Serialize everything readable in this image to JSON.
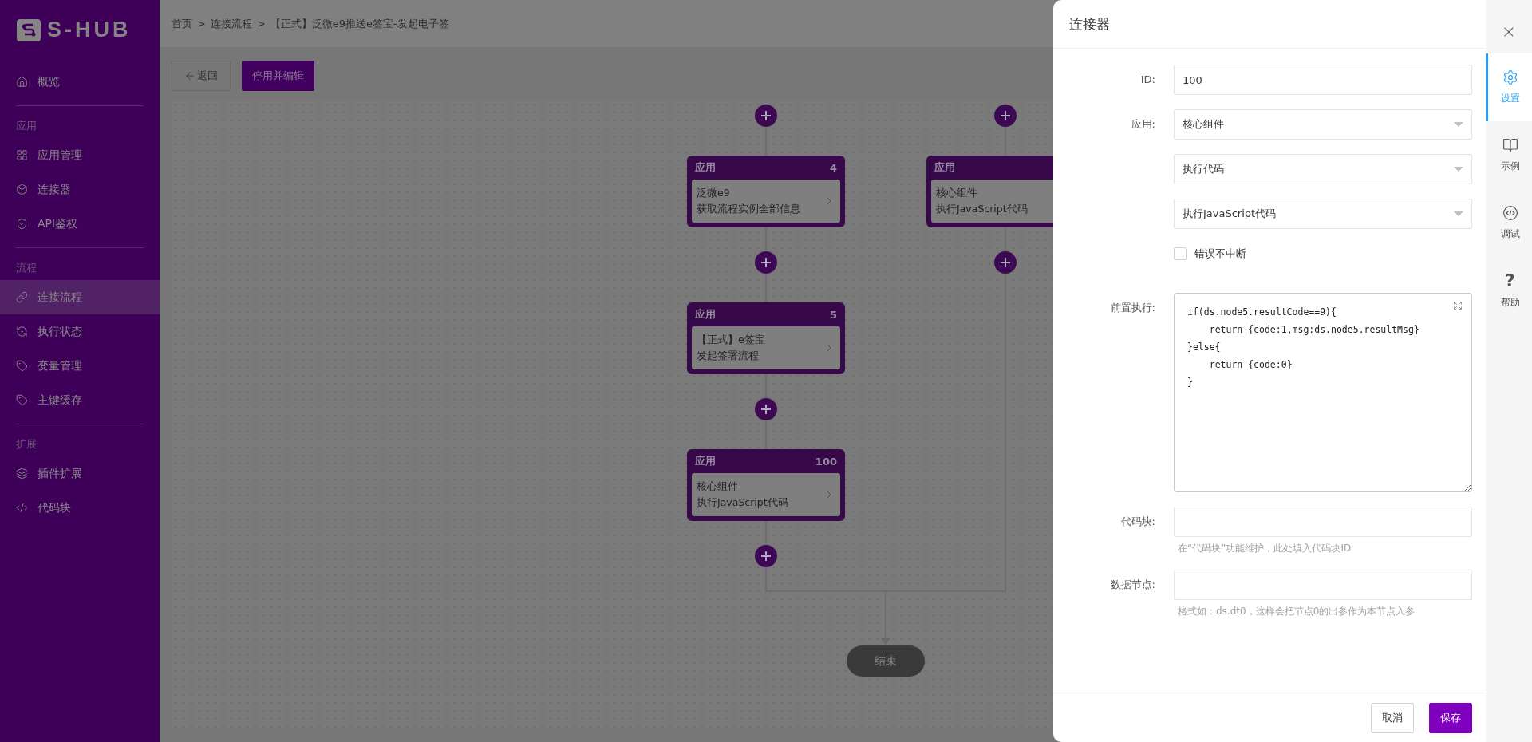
{
  "sidebar": {
    "logo": "S-HUB",
    "sections": [
      {
        "items": [
          {
            "label": "概览",
            "selected": false
          }
        ]
      },
      {
        "title": "应用",
        "items": [
          {
            "label": "应用管理",
            "selected": false
          },
          {
            "label": "连接器",
            "selected": false
          },
          {
            "label": "API鉴权",
            "selected": false
          }
        ]
      },
      {
        "title": "流程",
        "items": [
          {
            "label": "连接流程",
            "selected": true
          },
          {
            "label": "执行状态",
            "selected": false
          },
          {
            "label": "变量管理",
            "selected": false
          },
          {
            "label": "主键缓存",
            "selected": false
          }
        ]
      },
      {
        "title": "扩展",
        "items": [
          {
            "label": "插件扩展",
            "selected": false
          },
          {
            "label": "代码块",
            "selected": false
          }
        ]
      }
    ]
  },
  "breadcrumb": {
    "separator": ">",
    "items": [
      "首页",
      "连接流程",
      "【正式】泛微e9推送e签宝-发起电子签"
    ]
  },
  "toolbar": {
    "back_button": "返回",
    "primary_button": "停用并编辑"
  },
  "flow": {
    "columns": [
      {
        "nodes": [
          {
            "title": "应用",
            "number": "4",
            "lines": [
              "泛微e9",
              "获取流程实例全部信息"
            ]
          },
          {
            "title": "应用",
            "number": "5",
            "lines": [
              "【正式】e签宝",
              "发起签署流程"
            ]
          },
          {
            "title": "应用",
            "number": "100",
            "lines": [
              "核心组件",
              "执行JavaScript代码"
            ]
          }
        ]
      },
      {
        "nodes": [
          {
            "title": "应用",
            "lines": [
              "核心组件",
              "执行JavaScript代码"
            ]
          }
        ]
      }
    ],
    "end_label": "结束"
  },
  "drawer": {
    "title": "连接器",
    "fields": [
      {
        "kind": "input",
        "label": "ID:",
        "value": "100"
      },
      {
        "kind": "select",
        "label": "应用:",
        "value": "核心组件"
      },
      {
        "kind": "select",
        "value": "执行代码"
      },
      {
        "kind": "select",
        "value": "执行JavaScript代码"
      },
      {
        "kind": "checkbox",
        "label": "错误不中断",
        "checked": false
      },
      {
        "kind": "code",
        "label": "前置执行:",
        "lines": [
          "if(ds.node5.resultCode==9){",
          "    return {code:1,msg:ds.node5.resultMsg}",
          "}else{",
          "    return {code:0}",
          "}"
        ]
      },
      {
        "kind": "input",
        "label": "代码块:",
        "hint": "在“代码块”功能维护，此处填入代码块ID"
      },
      {
        "kind": "input",
        "label": "数据节点:",
        "hint": "格式如：ds.dt0，这样会把节点0的出参作为本节点入参"
      }
    ],
    "buttons": [
      {
        "label": "取消",
        "primary": false
      },
      {
        "label": "保存",
        "primary": true
      }
    ]
  },
  "side_tabs": [
    {
      "label": "设置",
      "selected": true
    },
    {
      "label": "示例",
      "selected": false
    },
    {
      "label": "调试",
      "selected": false
    },
    {
      "glyph": "?",
      "label": "帮助",
      "selected": false
    }
  ]
}
